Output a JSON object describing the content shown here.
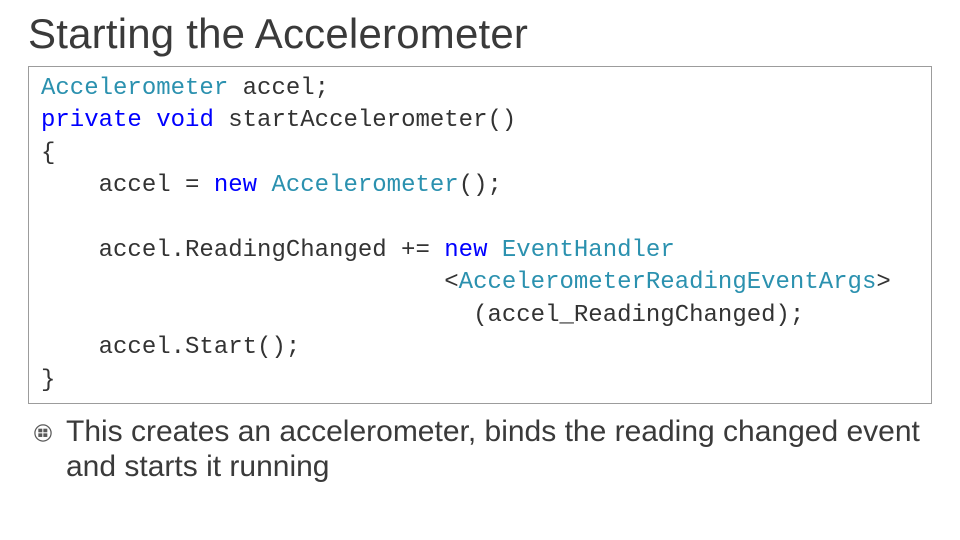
{
  "title": "Starting the Accelerometer",
  "code": {
    "l1a": "Accelerometer",
    "l1b": " accel;",
    "l2a": "private",
    "l2b": " ",
    "l2c": "void",
    "l2d": " startAccelerometer()",
    "l3": "{",
    "l4a": "    accel = ",
    "l4b": "new",
    "l4c": " ",
    "l4d": "Accelerometer",
    "l4e": "();",
    "blank": "",
    "l5a": "    accel.ReadingChanged += ",
    "l5b": "new",
    "l5c": " ",
    "l5d": "EventHandler",
    "l6a": "                            <",
    "l6b": "AccelerometerReadingEventArgs",
    "l6c": ">",
    "l7": "                              (accel_ReadingChanged);",
    "l8": "    accel.Start();",
    "l9": "}"
  },
  "bullet": "This creates an accelerometer, binds the reading changed event and starts it running"
}
